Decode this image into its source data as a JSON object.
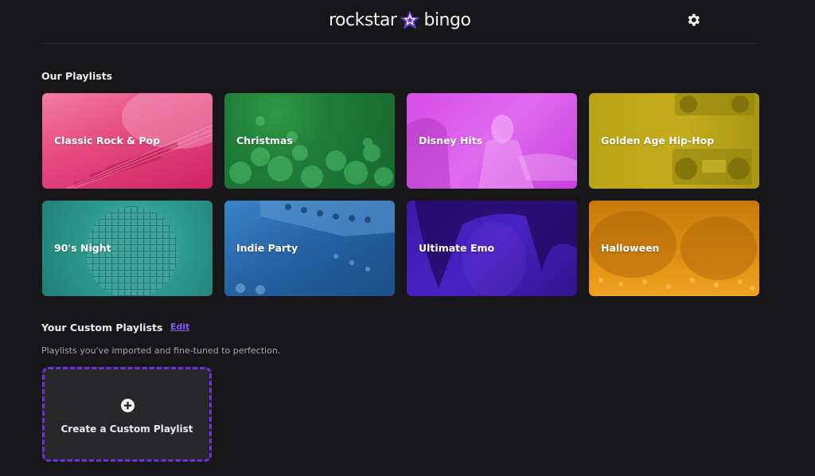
{
  "header": {
    "logo_left": "rockstar",
    "logo_right": "bingo",
    "logo_icon": "star-icon",
    "settings_icon": "gear-icon"
  },
  "our_playlists": {
    "title": "Our Playlists",
    "items": [
      {
        "label": "Classic Rock & Pop",
        "color": "#e54a7f"
      },
      {
        "label": "Christmas",
        "color": "#1f7a37"
      },
      {
        "label": "Disney Hits",
        "color": "#d64ee6"
      },
      {
        "label": "Golden Age Hip-Hop",
        "color": "#b8a415"
      },
      {
        "label": "90's Night",
        "color": "#2d9b8e"
      },
      {
        "label": "Indie Party",
        "color": "#2560a0"
      },
      {
        "label": "Ultimate Emo",
        "color": "#4a22c4"
      },
      {
        "label": "Halloween",
        "color": "#e0900f"
      }
    ]
  },
  "custom_playlists": {
    "title": "Your Custom Playlists",
    "edit_label": "Edit",
    "subtitle": "Playlists you've imported and fine-tuned to perfection.",
    "create_label": "Create a Custom Playlist",
    "create_icon": "plus-circle-icon"
  },
  "colors": {
    "background": "#171719",
    "accent": "#6a32e0",
    "link": "#8a5cf6",
    "card_dark": "#27272a"
  }
}
